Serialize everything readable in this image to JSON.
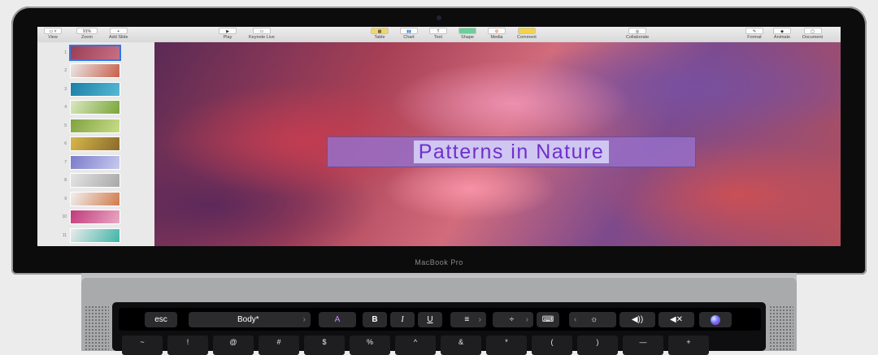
{
  "toolbar": {
    "view": {
      "label": "View"
    },
    "zoom": {
      "value": "91%",
      "label": "Zoom"
    },
    "add_slide": {
      "label": "Add Slide"
    },
    "play": {
      "label": "Play"
    },
    "keynote_live": {
      "label": "Keynote Live"
    },
    "table": {
      "label": "Table"
    },
    "chart": {
      "label": "Chart"
    },
    "text": {
      "label": "Text"
    },
    "shape": {
      "label": "Shape"
    },
    "media": {
      "label": "Media"
    },
    "comment": {
      "label": "Comment"
    },
    "collaborate": {
      "label": "Collaborate"
    },
    "format": {
      "label": "Format"
    },
    "animate": {
      "label": "Animate"
    },
    "document": {
      "label": "Document"
    }
  },
  "sidebar": {
    "slides": [
      {
        "number": "1",
        "colors": [
          "#9a3e55",
          "#c97085"
        ],
        "selected": true
      },
      {
        "number": "2",
        "colors": [
          "#e8e8e8",
          "#c95f4a"
        ]
      },
      {
        "number": "3",
        "colors": [
          "#1c7fa6",
          "#55b9d4"
        ]
      },
      {
        "number": "4",
        "colors": [
          "#d9e8c0",
          "#7aa53a"
        ]
      },
      {
        "number": "5",
        "colors": [
          "#7fa340",
          "#c9dc87"
        ]
      },
      {
        "number": "6",
        "colors": [
          "#d7b84a",
          "#8a6a2a"
        ]
      },
      {
        "number": "7",
        "colors": [
          "#7a7cc8",
          "#c8c9ef"
        ]
      },
      {
        "number": "8",
        "colors": [
          "#e4e4e4",
          "#a8a8a8"
        ]
      },
      {
        "number": "9",
        "colors": [
          "#f0f0f0",
          "#d27a4a"
        ]
      },
      {
        "number": "10",
        "colors": [
          "#c03b7a",
          "#e9a8c4"
        ]
      },
      {
        "number": "11",
        "colors": [
          "#eaeaea",
          "#3fb5a8"
        ]
      }
    ]
  },
  "slide": {
    "title": "Patterns in Nature"
  },
  "laptop": {
    "brand": "MacBook Pro"
  },
  "touch_bar": {
    "esc": "esc",
    "style": "Body*",
    "style_chevron": "›",
    "font_color": "A",
    "bold": "B",
    "italic": "I",
    "underline": "U",
    "align": "≡",
    "align_chevron": "›",
    "indent": "÷",
    "indent_chevron": "›",
    "collapse": "‹",
    "brightness": "☼",
    "volume": "◀))",
    "mute": "◀✕"
  },
  "keyboard": {
    "keys": [
      "~",
      "!",
      "@",
      "#",
      "$",
      "%",
      "^",
      "&",
      "*",
      "(",
      ")",
      "—",
      "+"
    ]
  },
  "colors": {
    "title_text": "#6f30c9",
    "title_highlight": "#cfc6f2",
    "selection_blue": "#2b78e4"
  }
}
